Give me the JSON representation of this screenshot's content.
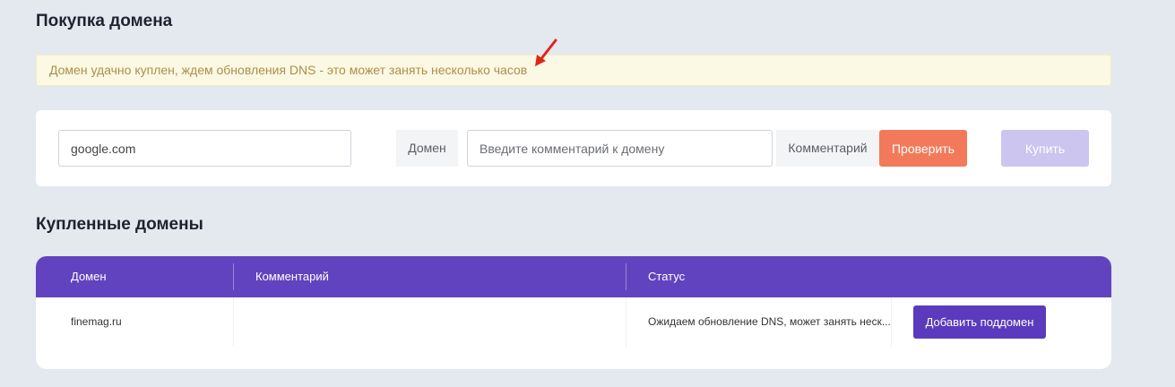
{
  "purchase": {
    "title": "Покупка домена",
    "alert_text": "Домен удачно куплен, ждем обновления DNS - это может занять несколько часов",
    "domain_input_value": "google.com",
    "domain_addon": "Домен",
    "comment_placeholder": "Введите комментарий к домену",
    "comment_addon": "Комментарий",
    "check_label": "Проверить",
    "buy_label": "Купить"
  },
  "bought": {
    "title": "Купленные домены",
    "columns": [
      "Домен",
      "Комментарий",
      "Статус"
    ],
    "rows": [
      {
        "domain": "finemag.ru",
        "comment": "",
        "status": "Ожидаем обновление DNS, может занять неск...",
        "action_label": "Добавить поддомен"
      }
    ]
  },
  "colors": {
    "background": "#e4e8ef",
    "accent_purple": "#6243bf",
    "check_button": "#f27a5a",
    "buy_button_disabled": "#cbc5ef",
    "alert_bg": "#fbf8e3",
    "alert_text": "#ac8f4c",
    "annotation_arrow": "#e0241b"
  }
}
